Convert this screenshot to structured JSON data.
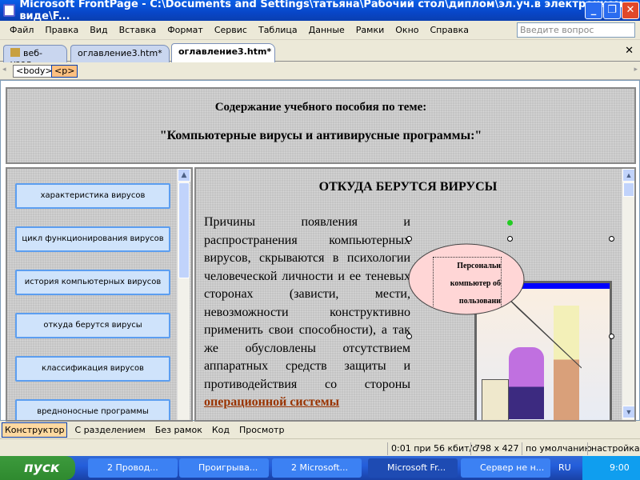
{
  "window": {
    "title": "Microsoft FrontPage - C:\\Documents and Settings\\татьяна\\Рабочий стол\\диплом\\эл.уч.в электронном виде\\F...",
    "controls": [
      "_",
      "❐",
      "✕"
    ]
  },
  "menu": {
    "items": [
      "Файл",
      "Правка",
      "Вид",
      "Вставка",
      "Формат",
      "Сервис",
      "Таблица",
      "Данные",
      "Рамки",
      "Окно",
      "Справка"
    ],
    "ask_placeholder": "Введите вопрос"
  },
  "tabs": [
    {
      "label": "веб-узел"
    },
    {
      "label": "оглавление3.htm*"
    },
    {
      "label": "оглавление3.htm*",
      "active": true
    }
  ],
  "tagbar": {
    "tags": [
      "<body>",
      "<p>"
    ]
  },
  "page": {
    "header_line1": "Содержание учебного пособия по теме:",
    "header_line2": "\"Компьютерные вирусы и антивирусные программы:\"",
    "nav": [
      "характеристика вирусов",
      "цикл функционирования вирусов",
      "история компьютерных вирусов",
      "откуда берутся вирусы",
      "классификация вирусов",
      "вредноносные программы"
    ],
    "main_heading": "ОТКУДА БЕРУТСЯ ВИРУСЫ",
    "paragraph": "Причины появления и распространения компьютерных вирусов, скрываются в психологии человеческой личности и ее теневых сторонах (зависти, мести, невозможности конструктивно применить свои способности), а так же обусловлены отсутствием аппаратных средств защиты и противодействия со стороны",
    "link_text": "операционной системы",
    "callout": [
      "Персональн",
      "компьютер об",
      "пользовани"
    ]
  },
  "viewbar": {
    "items": [
      "Конструктор",
      "С разделением",
      "Без рамок",
      "Код",
      "Просмотр"
    ],
    "active": "Конструктор"
  },
  "status": {
    "speed": "0:01 при 56 кбит/с",
    "size": "798 x 427",
    "default": "по умолчанию",
    "custom": "настройка"
  },
  "taskbar": {
    "start": "пуск",
    "items": [
      "2 Провод...",
      "Проигрыва...",
      "2 Microsoft...",
      "Microsoft Fr...",
      "Сервер не н..."
    ],
    "active_index": 3,
    "lang": "RU",
    "clock": "9:00"
  },
  "colors": {
    "titlebar": "#0846c8",
    "link": "#993300",
    "nav_button": "#cfe3fb",
    "callout": "#ffd6d6"
  }
}
